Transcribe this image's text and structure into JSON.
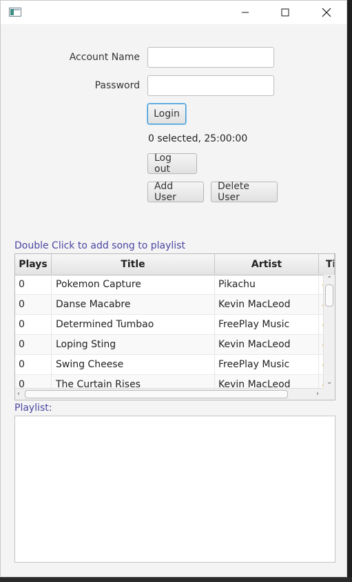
{
  "window": {
    "icon": "app-window-icon",
    "controls": [
      "minimize-icon",
      "maximize-icon",
      "close-icon"
    ]
  },
  "login": {
    "account_label": "Account Name",
    "account_value": "",
    "password_label": "Password",
    "password_value": "",
    "login_button": "Login",
    "status": "0 selected, 25:00:00",
    "logout_button": "Log out",
    "add_user_button": "Add User",
    "delete_user_button": "Delete User"
  },
  "songs": {
    "caption": "Double Click to add song to playlist",
    "columns": [
      "Plays",
      "Title",
      "Artist",
      "Ti"
    ],
    "rows": [
      {
        "plays": "0",
        "title": "Pokemon Capture",
        "artist": "Pikachu"
      },
      {
        "plays": "0",
        "title": "Danse Macabre",
        "artist": "Kevin MacLeod"
      },
      {
        "plays": "0",
        "title": "Determined Tumbao",
        "artist": "FreePlay Music"
      },
      {
        "plays": "0",
        "title": "Loping Sting",
        "artist": "Kevin MacLeod"
      },
      {
        "plays": "0",
        "title": "Swing Cheese",
        "artist": "FreePlay Music"
      },
      {
        "plays": "0",
        "title": "The Curtain Rises",
        "artist": "Kevin MacLeod"
      }
    ]
  },
  "playlist": {
    "caption": "Playlist:"
  },
  "colors": {
    "caption": "#4a45a0",
    "focus": "#3a9bd6",
    "window_bg": "#f4f4f4"
  }
}
